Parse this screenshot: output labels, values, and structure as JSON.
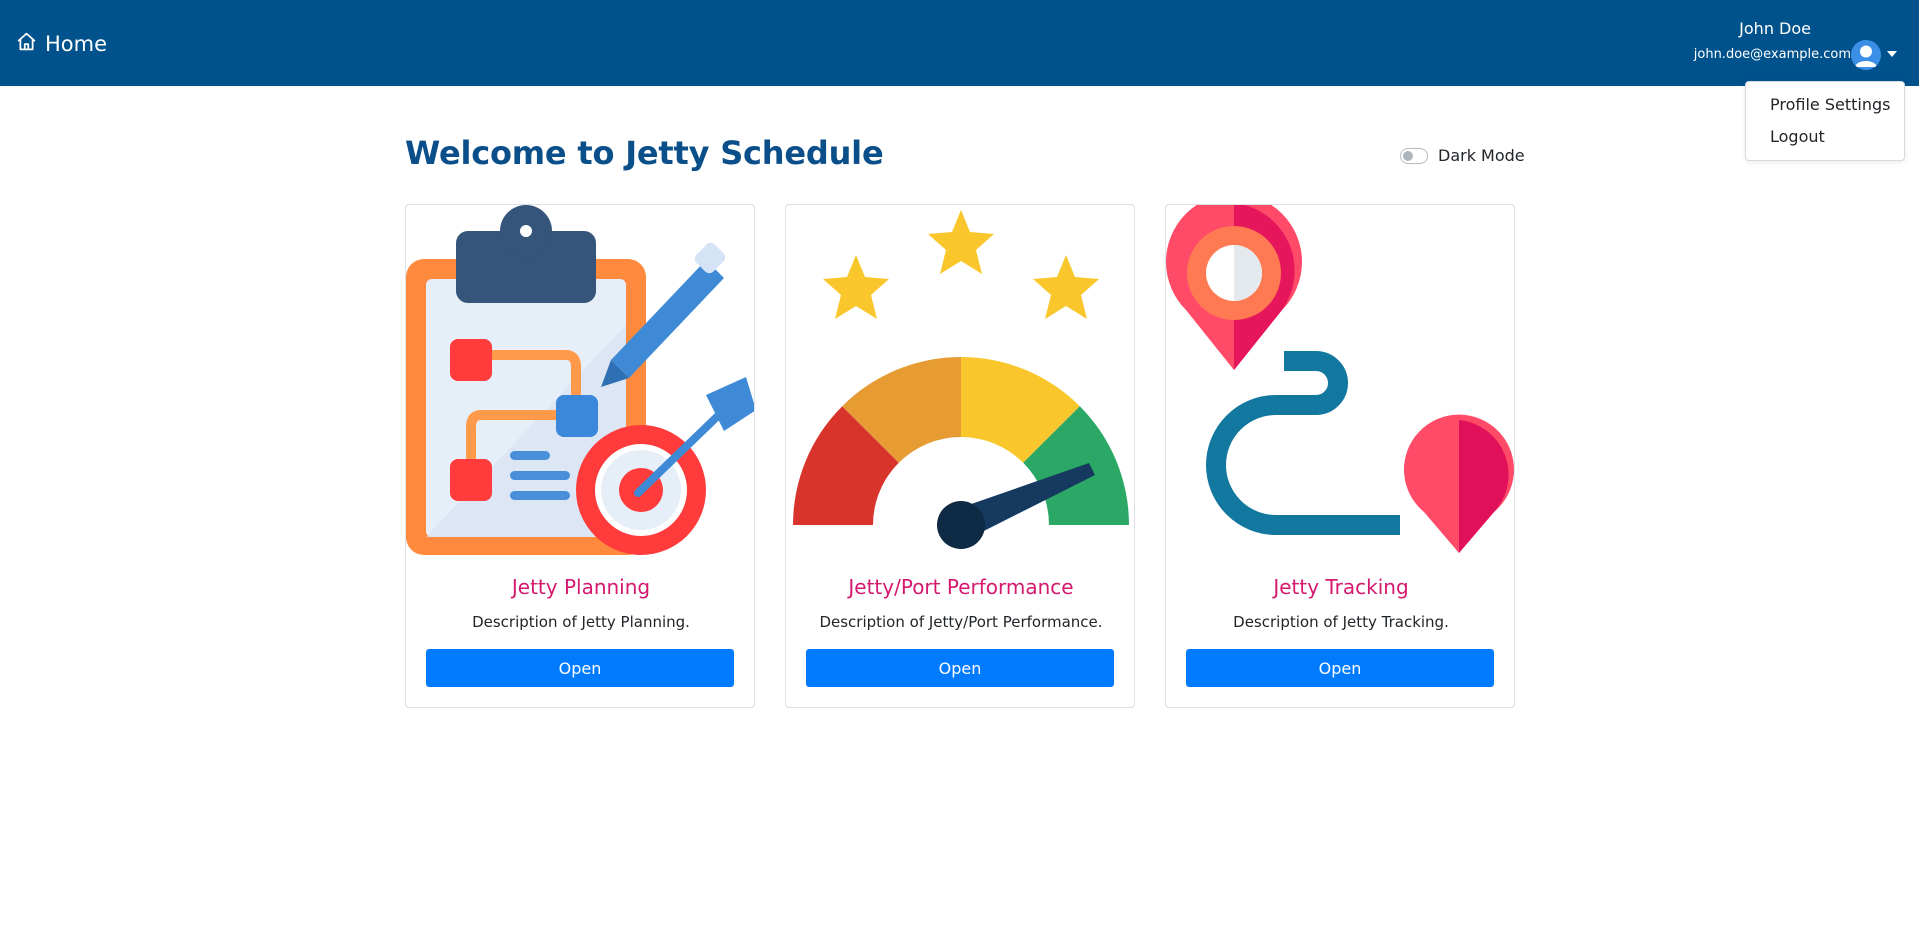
{
  "header": {
    "brand_label": "Home",
    "brand_icon": "home-icon",
    "user_name": "John Doe",
    "user_email": "john.doe@example.com",
    "avatar_icon": "user-avatar-icon",
    "background_color": "#00528c"
  },
  "user_menu": {
    "items": [
      {
        "label": "Profile Settings"
      },
      {
        "label": "Logout"
      }
    ]
  },
  "main": {
    "title": "Welcome to Jetty Schedule",
    "dark_mode_label": "Dark Mode",
    "dark_mode_enabled": false,
    "title_color": "#0b4f8a"
  },
  "cards": [
    {
      "title": "Jetty Planning",
      "description": "Description of Jetty Planning.",
      "button_label": "Open",
      "illustration": "clipboard-target-icon"
    },
    {
      "title": "Jetty/Port Performance",
      "description": "Description of Jetty/Port Performance.",
      "button_label": "Open",
      "illustration": "gauge-stars-icon"
    },
    {
      "title": "Jetty Tracking",
      "description": "Description of Jetty Tracking.",
      "button_label": "Open",
      "illustration": "map-route-pins-icon"
    }
  ],
  "colors": {
    "accent_button": "#007bff",
    "card_title": "#d4196e"
  }
}
